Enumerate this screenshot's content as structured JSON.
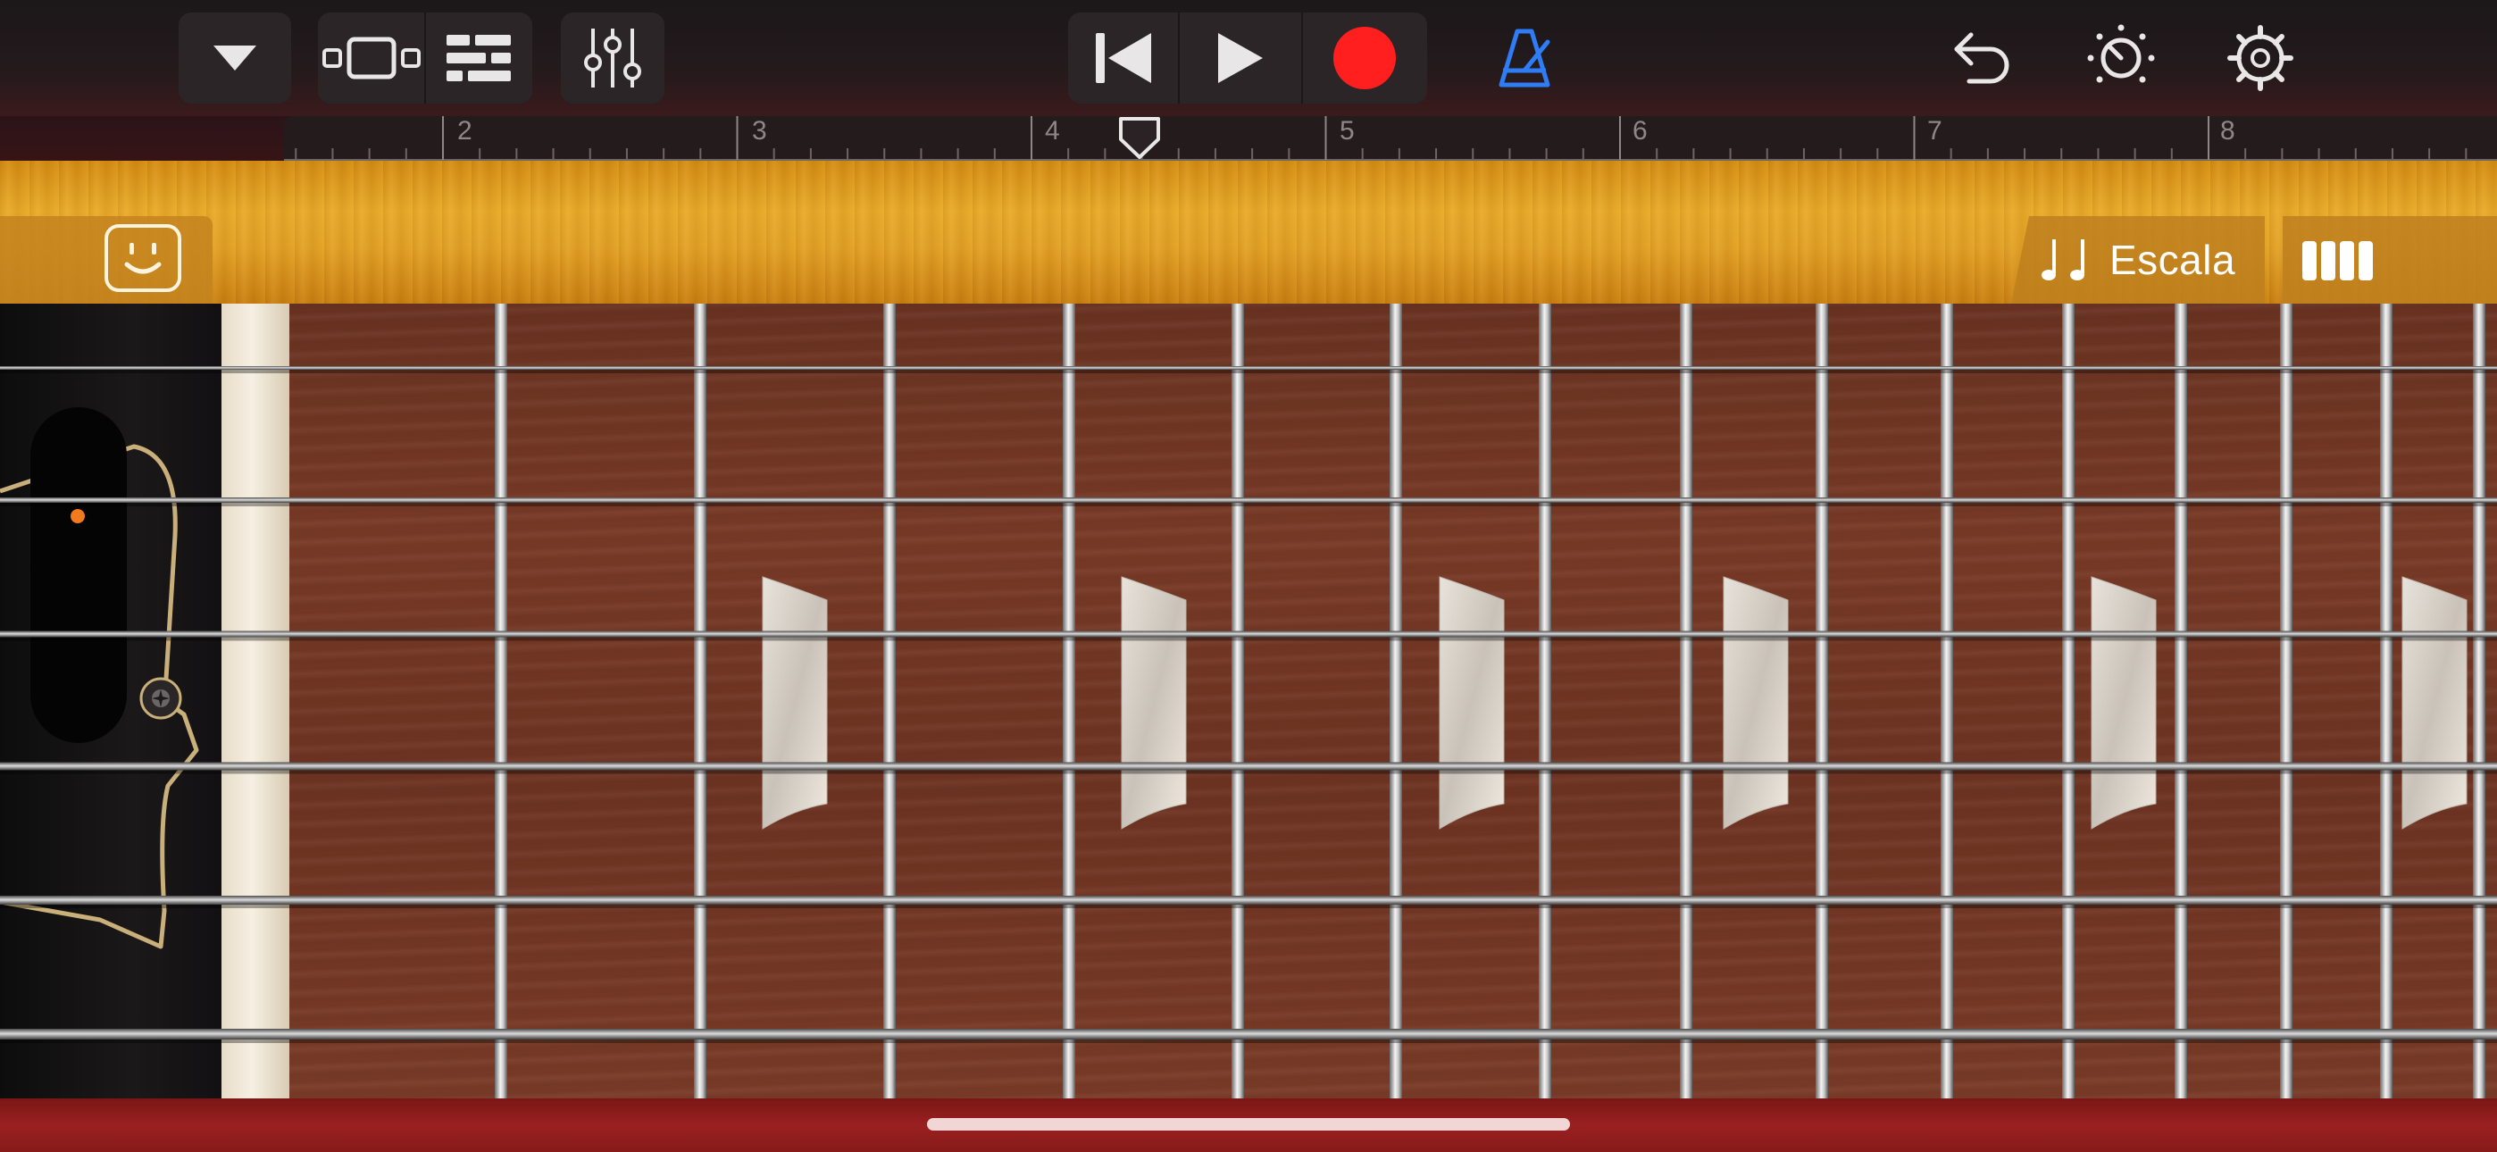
{
  "toolbar": {
    "browser_icon": "triangle-down-icon",
    "tracks_icon": "tracks-view-icon",
    "list_icon": "list-view-icon",
    "mixer_icon": "mixer-sliders-icon",
    "rewind_icon": "skip-back-icon",
    "play_icon": "play-icon",
    "record_icon": "record-icon",
    "metronome_icon": "metronome-icon",
    "undo_icon": "undo-icon",
    "master_icon": "master-knob-icon",
    "settings_icon": "gear-icon"
  },
  "ruler": {
    "bars": [
      "2",
      "3",
      "4",
      "5",
      "6",
      "7",
      "8"
    ]
  },
  "instrument": {
    "scale_label": "Escala",
    "smiley_icon": "smart-controls-icon",
    "strings_view_icon": "strings-view-icon"
  },
  "colors": {
    "record": "#ff1f1f",
    "metronome": "#2f7df6",
    "maple": "#e3a126",
    "rosewood": "#6f3423",
    "pickguard_outline": "#c9b07a",
    "volume_dot": "#f07a1c"
  }
}
